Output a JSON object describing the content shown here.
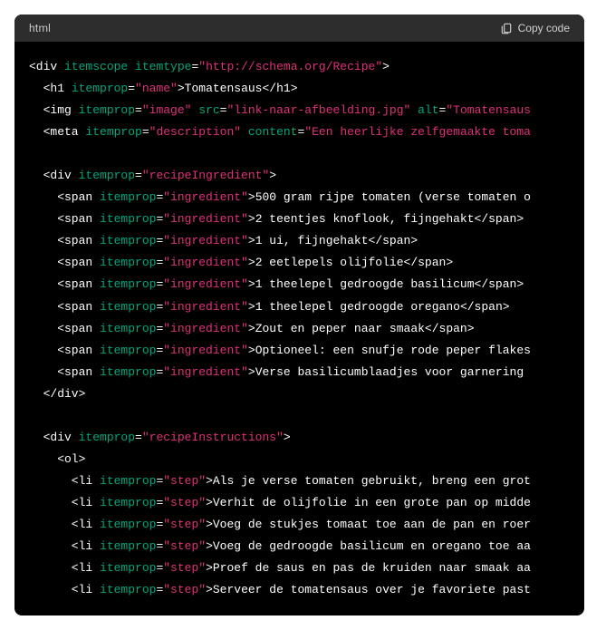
{
  "header": {
    "language": "html",
    "copy_label": "Copy code"
  },
  "code": {
    "line1_open": "<div ",
    "line1_attr1": "itemscope",
    "line1_space": " ",
    "line1_attr2": "itemtype",
    "line1_eq": "=",
    "line1_val": "\"http://schema.org/Recipe\"",
    "line1_close": ">",
    "line2_open": "  <h1 ",
    "line2_attr": "itemprop",
    "line2_eq": "=",
    "line2_val": "\"name\"",
    "line2_mid": ">",
    "line2_text": "Tomatensaus",
    "line2_close": "</h1>",
    "line3_open": "  <img ",
    "line3_attr1": "itemprop",
    "line3_eq1": "=",
    "line3_val1": "\"image\"",
    "line3_attr2": " src",
    "line3_eq2": "=",
    "line3_val2": "\"link-naar-afbeelding.jpg\"",
    "line3_attr3": " alt",
    "line3_eq3": "=",
    "line3_val3": "\"Tomatensaus",
    "line4_open": "  <meta ",
    "line4_attr1": "itemprop",
    "line4_eq1": "=",
    "line4_val1": "\"description\"",
    "line4_attr2": " content",
    "line4_eq2": "=",
    "line4_val2": "\"Een heerlijke zelfgemaakte toma",
    "line5": "",
    "line6_open": "  <div ",
    "line6_attr": "itemprop",
    "line6_eq": "=",
    "line6_val": "\"recipeIngredient\"",
    "line6_close": ">",
    "ing_open": "    <span ",
    "ing_attr": "itemprop",
    "ing_eq": "=",
    "ing_val": "\"ingredient\"",
    "ing_mid": ">",
    "ing1_text": "500 gram rijpe tomaten (verse tomaten o",
    "ing2_text": "2 teentjes knoflook, fijngehakt",
    "ing3_text": "1 ui, fijngehakt",
    "ing4_text": "2 eetlepels olijfolie",
    "ing5_text": "1 theelepel gedroogde basilicum",
    "ing6_text": "1 theelepel gedroogde oregano",
    "ing7_text": "Zout en peper naar smaak",
    "ing8_text": "Optioneel: een snufje rode peper flakes",
    "ing9_text": "Verse basilicumblaadjes voor garnering ",
    "span_close": "</span>",
    "line16": "  </div>",
    "line17": "",
    "line18_open": "  <div ",
    "line18_attr": "itemprop",
    "line18_eq": "=",
    "line18_val": "\"recipeInstructions\"",
    "line18_close": ">",
    "line19": "    <ol>",
    "step_open": "      <li ",
    "step_attr": "itemprop",
    "step_eq": "=",
    "step_val": "\"step\"",
    "step_mid": ">",
    "step1_text": "Als je verse tomaten gebruikt, breng een grot",
    "step2_text": "Verhit de olijfolie in een grote pan op midde",
    "step3_text": "Voeg de stukjes tomaat toe aan de pan en roer",
    "step4_text": "Voeg de gedroogde basilicum en oregano toe aa",
    "step5_text": "Proef de saus en pas de kruiden naar smaak aa",
    "step6_text": "Serveer de tomatensaus over je favoriete past"
  }
}
